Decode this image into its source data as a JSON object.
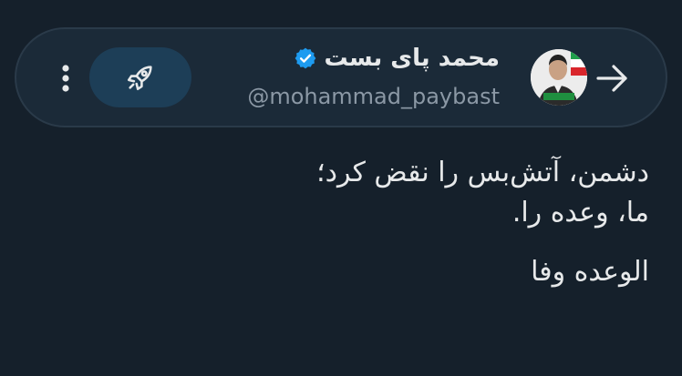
{
  "profile": {
    "display_name": "محمد پای بست",
    "handle": "@mohammad_paybast",
    "avatar_caption": "محمد پای بست",
    "verified": true
  },
  "tweet": {
    "line1": "دشمن، آتش‌بس را نقض کرد؛",
    "line2": "ما، وعده را.",
    "line3": "الوعده وفا"
  },
  "icons": {
    "back": "arrow-right-icon",
    "verified": "verified-badge-icon",
    "boost": "rocket-icon",
    "more": "more-vertical-icon"
  },
  "colors": {
    "background": "#15202b",
    "header_bg": "#1b2a38",
    "accent": "#1d9bf0",
    "text": "#e7e9ea",
    "muted": "#8b98a5"
  }
}
